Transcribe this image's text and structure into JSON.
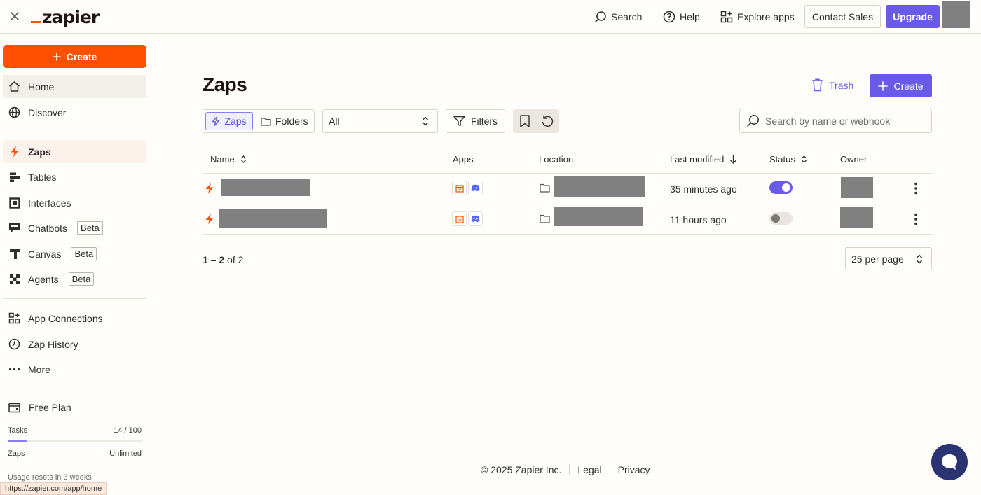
{
  "topbar": {
    "logo": "zapier",
    "search_label": "Search",
    "help_label": "Help",
    "explore_label": "Explore apps",
    "contact_label": "Contact Sales",
    "upgrade_label": "Upgrade"
  },
  "sidebar": {
    "create_label": "Create",
    "items": [
      {
        "label": "Home",
        "icon": "home-icon"
      },
      {
        "label": "Discover",
        "icon": "globe-icon"
      },
      {
        "label": "Zaps",
        "icon": "bolt-icon"
      },
      {
        "label": "Tables",
        "icon": "tables-icon"
      },
      {
        "label": "Interfaces",
        "icon": "interfaces-icon"
      },
      {
        "label": "Chatbots",
        "icon": "chatbot-icon",
        "badge": "Beta"
      },
      {
        "label": "Canvas",
        "icon": "canvas-icon",
        "badge": "Beta"
      },
      {
        "label": "Agents",
        "icon": "agents-icon",
        "badge": "Beta"
      },
      {
        "label": "App Connections",
        "icon": "app-connections-icon"
      },
      {
        "label": "Zap History",
        "icon": "clock-icon"
      },
      {
        "label": "More",
        "icon": "more-dots-icon"
      }
    ],
    "plan": {
      "title": "Free Plan",
      "tasks_label": "Tasks",
      "tasks_value": "14 / 100",
      "tasks_fraction": 0.14,
      "zaps_label": "Zaps",
      "zaps_value": "Unlimited",
      "reset_text": "Usage resets in 3 weeks"
    },
    "status_url": "https://zapier.com/app/home"
  },
  "main": {
    "title": "Zaps",
    "trash_label": "Trash",
    "create_label": "Create",
    "toggle": {
      "zaps": "Zaps",
      "folders": "Folders"
    },
    "filter_select": "All",
    "filters_label": "Filters",
    "search_placeholder": "Search by name or webhook",
    "columns": {
      "name": "Name",
      "apps": "Apps",
      "location": "Location",
      "last_modified": "Last modified",
      "status": "Status",
      "owner": "Owner"
    },
    "rows": [
      {
        "modified": "35 minutes ago",
        "status_on": true
      },
      {
        "modified": "11 hours ago",
        "status_on": false
      }
    ],
    "pager": {
      "range": "1 – 2",
      "of": "of",
      "total": "2"
    },
    "per_page": "25 per page"
  },
  "footer": {
    "copyright": "© 2025 Zapier Inc.",
    "legal": "Legal",
    "privacy": "Privacy"
  },
  "colors": {
    "brand_orange": "#ff4f00",
    "accent_purple": "#695be8",
    "background": "#fffdf9"
  }
}
